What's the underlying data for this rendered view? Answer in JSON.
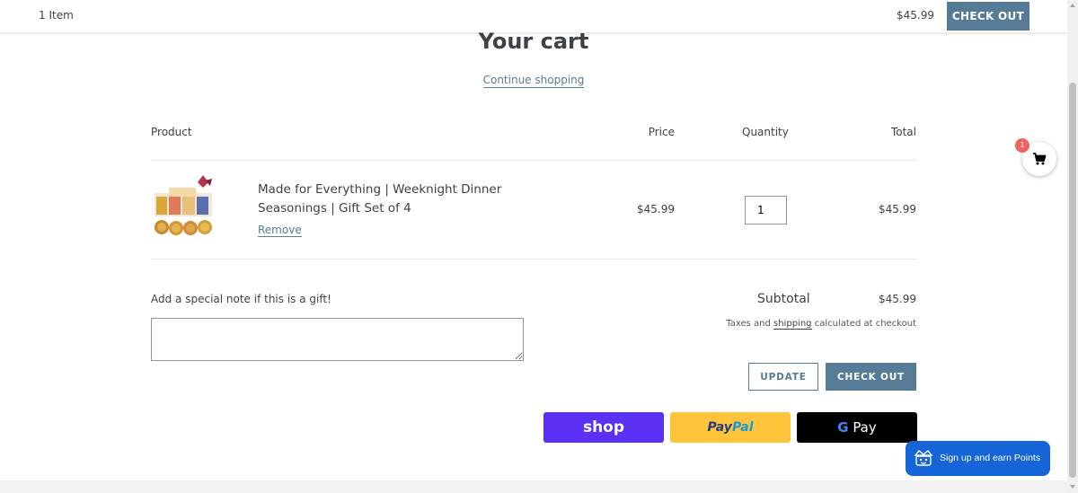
{
  "topbar": {
    "item_count": "1 Item",
    "price": "$45.99",
    "checkout_label": "CHECK OUT"
  },
  "page": {
    "title": "Your cart",
    "continue_label": "Continue shopping"
  },
  "table": {
    "headers": {
      "product": "Product",
      "price": "Price",
      "quantity": "Quantity",
      "total": "Total"
    },
    "items": [
      {
        "name": "Made for Everything | Weeknight Dinner Seasonings | Gift Set of 4",
        "remove_label": "Remove",
        "price": "$45.99",
        "quantity": "1",
        "total": "$45.99"
      }
    ]
  },
  "note": {
    "label": "Add a special note if this is a gift!",
    "value": ""
  },
  "summary": {
    "subtotal_label": "Subtotal",
    "subtotal_value": "$45.99",
    "taxes_prefix": "Taxes and",
    "taxes_link": "shipping",
    "taxes_suffix": "calculated at checkout",
    "update_label": "UPDATE",
    "checkout_label": "CHECK OUT"
  },
  "payments": {
    "shop": "shop",
    "paypal_a": "Pay",
    "paypal_b": "Pal",
    "gpay_g": "G",
    "gpay_text": "Pay"
  },
  "cart_fab": {
    "badge": "1"
  },
  "rewards": {
    "label": "Sign up and earn Points"
  },
  "colors": {
    "accent": "#557b97",
    "shop": "#5a31f4",
    "paypal": "#ffc439",
    "gpay": "#000000",
    "rewards": "#1565d8",
    "badge": "#ef6363"
  },
  "icons": [
    "cart-icon",
    "rewards-icon",
    "scroll-up-icon",
    "scroll-down-icon"
  ]
}
